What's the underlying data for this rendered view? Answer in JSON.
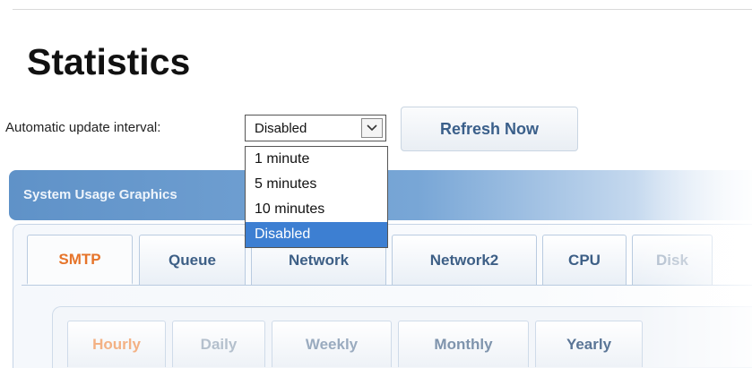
{
  "page": {
    "title": "Statistics"
  },
  "controls": {
    "interval_label": "Automatic update interval:",
    "interval_value": "Disabled",
    "refresh_label": "Refresh Now",
    "options": [
      {
        "label": "1 minute",
        "selected": false
      },
      {
        "label": "5 minutes",
        "selected": false
      },
      {
        "label": "10 minutes",
        "selected": false
      },
      {
        "label": "Disabled",
        "selected": true
      }
    ]
  },
  "panel": {
    "header": "System Usage Graphics"
  },
  "tabs": [
    {
      "label": "SMTP",
      "active": true
    },
    {
      "label": "Queue",
      "active": false
    },
    {
      "label": "Network",
      "active": false
    },
    {
      "label": "Network2",
      "active": false
    },
    {
      "label": "CPU",
      "active": false
    },
    {
      "label": "Disk",
      "active": false
    }
  ],
  "subtabs": [
    {
      "label": "Hourly",
      "active": true
    },
    {
      "label": "Daily",
      "active": false
    },
    {
      "label": "Weekly",
      "active": false
    },
    {
      "label": "Monthly",
      "active": false
    },
    {
      "label": "Yearly",
      "active": false
    }
  ],
  "colors": {
    "accent": "#e6742a",
    "header": "#5f92c8",
    "selection": "#3d7fd2"
  },
  "icons": {
    "select_arrow": "chevron-down-icon"
  }
}
